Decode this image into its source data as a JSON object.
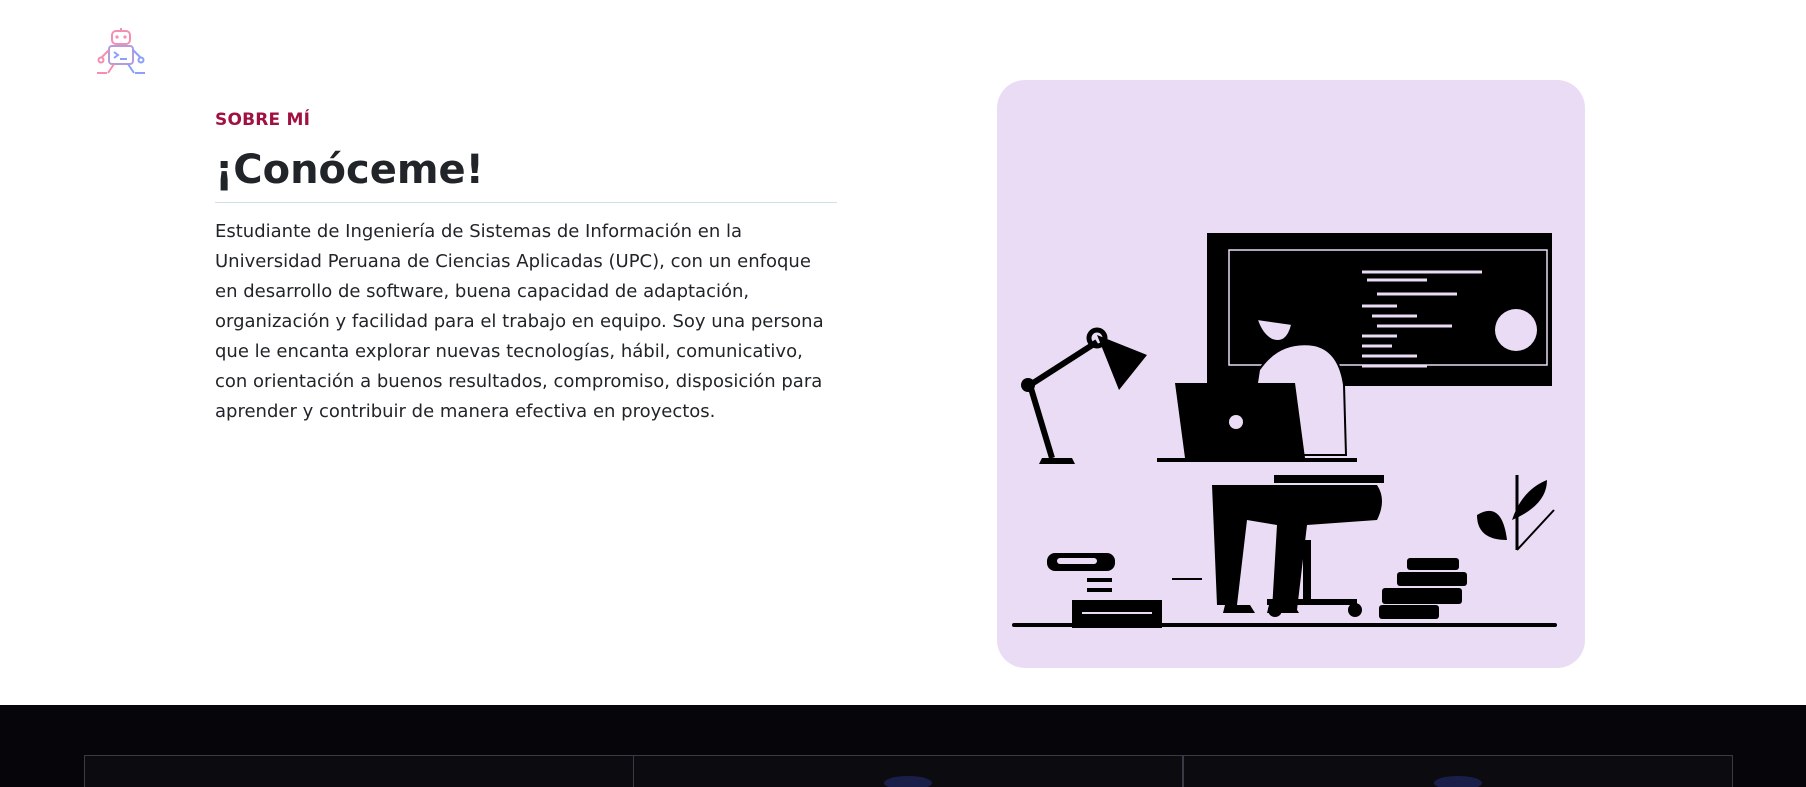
{
  "logo": {
    "icon": "robot-terminal-icon",
    "colors": [
      "#f48fb1",
      "#8c9eff"
    ]
  },
  "about": {
    "eyebrow": "SOBRE MÍ",
    "title": "¡Conóceme!",
    "description": "Estudiante de Ingeniería de Sistemas de Información en la Universidad Peruana de Ciencias Aplicadas (UPC), con un enfoque en desarrollo de software, buena capacidad de adaptación, organización y facilidad para el trabajo en equipo. Soy una persona que le encanta explorar nuevas tecnologías, hábil, comunicativo, con orientación a buenos resultados, compromiso, disposición para aprender y contribuir de manera efectiva en proyectos."
  },
  "illustration": {
    "subject": "person-working-at-laptop-illustration",
    "background_color": "#eadcf5"
  },
  "colors": {
    "accent": "#a1113f",
    "text": "#212529",
    "footer_background": "#05050a"
  }
}
